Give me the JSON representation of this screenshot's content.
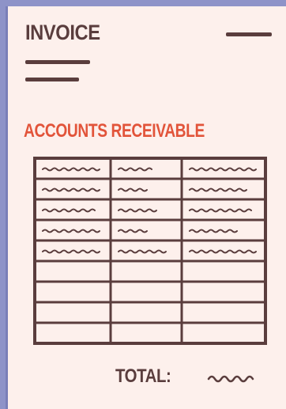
{
  "document": {
    "title": "INVOICE",
    "section_heading": "ACCOUNTS RECEIVABLE",
    "total_label": "TOTAL:"
  },
  "table": {
    "columns": 3,
    "rows": 9,
    "filled_rows": 5
  },
  "colors": {
    "background": "#8e93c8",
    "paper": "#fdf0ec",
    "ink": "#5a3d3d",
    "accent": "#e2543a"
  }
}
